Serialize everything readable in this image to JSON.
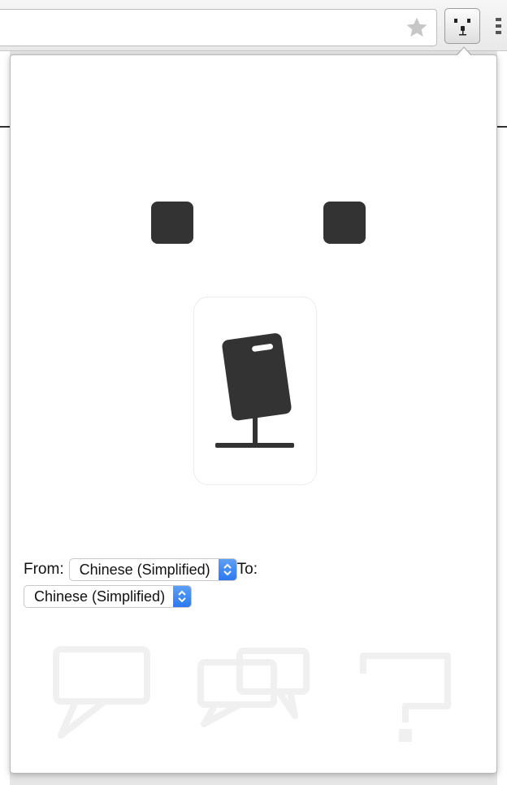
{
  "toolbar": {
    "icons": [
      "star-icon",
      "polar-bear-icon",
      "menu-icon"
    ]
  },
  "popup": {
    "from_label": "From:",
    "from_value": "Chinese (Simplified)",
    "to_label": "To:",
    "to_value": "Chinese (Simplified)",
    "mic_icon": "microphone-icon",
    "bottom_icons": [
      "speech-bubble-icon",
      "conversation-icon",
      "help-icon"
    ]
  },
  "colors": {
    "dark": "#333333",
    "select_accent": "#2c78ef",
    "faded_icon": "#f0f0f0"
  }
}
